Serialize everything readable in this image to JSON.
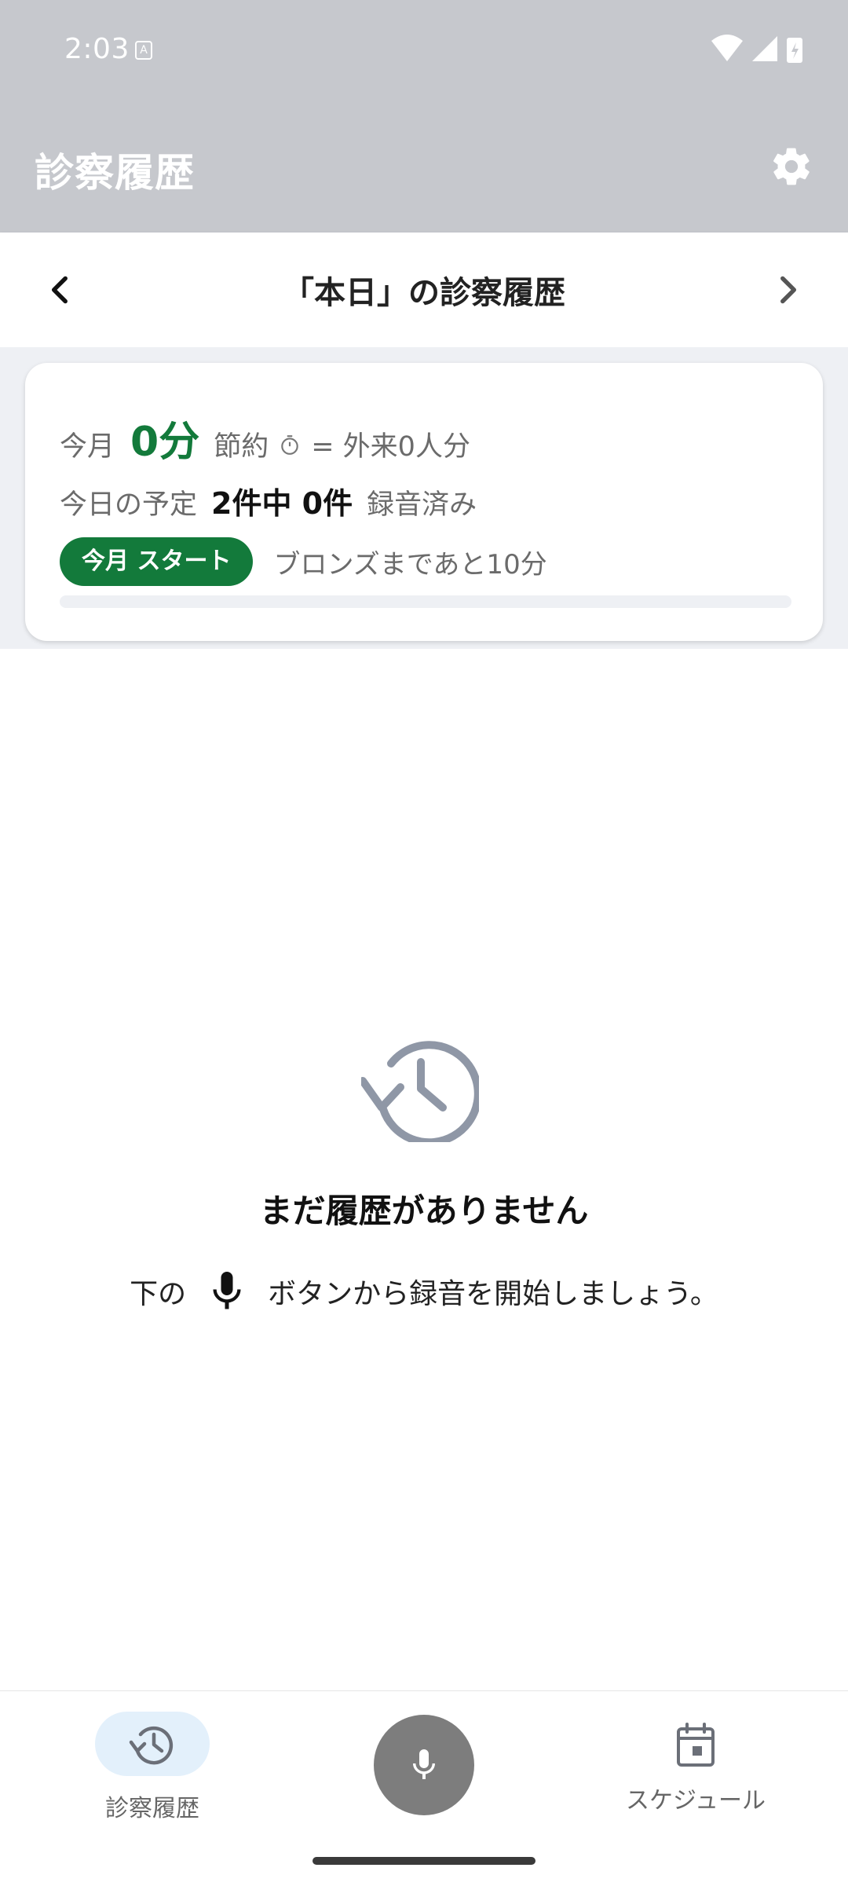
{
  "status_bar": {
    "time": "2:03"
  },
  "app_bar": {
    "title": "診察履歴"
  },
  "date_nav": {
    "title": "「本日」の診察履歴"
  },
  "stats": {
    "month_label": "今月",
    "saved_value": "0分",
    "saved_label": "節約",
    "saved_equiv": "= 外来0人分",
    "today_label": "今日の予定",
    "today_count": "2件中 0件",
    "today_suffix": "録音済み",
    "badge_label": "今月 スタート",
    "next_level_text": "ブロンズまであと10分",
    "progress_fraction": 0
  },
  "empty_state": {
    "title": "まだ履歴がありません",
    "hint_prefix": "下の",
    "hint_suffix": "ボタンから録音を開始しましょう。"
  },
  "bottom_nav": {
    "history_label": "診察履歴",
    "schedule_label": "スケジュール"
  },
  "colors": {
    "accent_green": "#137a3b",
    "app_bar": "#c6c8cd",
    "mic_button": "#7d7d7d"
  }
}
